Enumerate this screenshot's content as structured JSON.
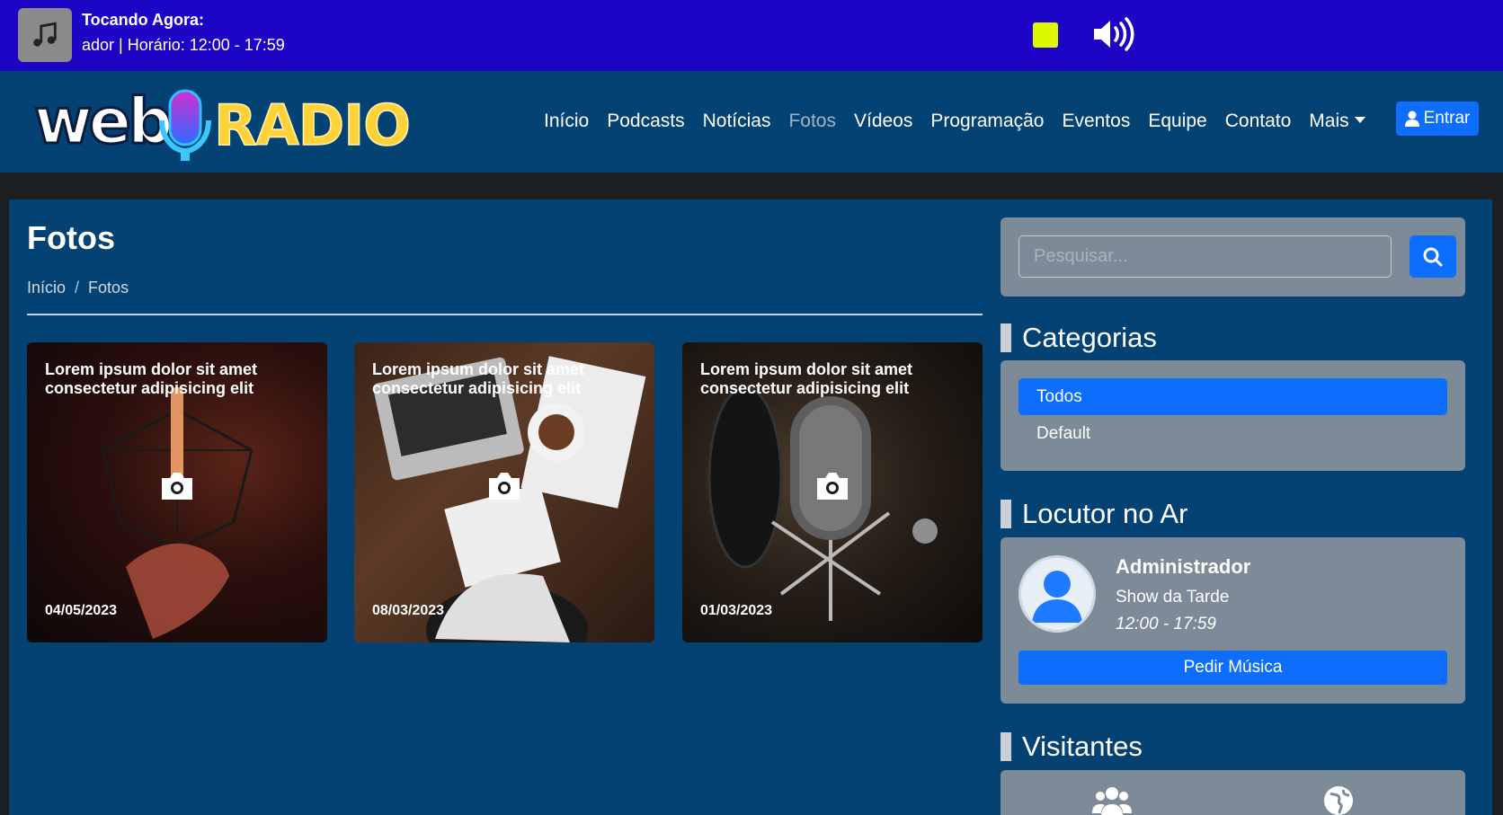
{
  "player": {
    "now_playing_label": "Tocando Agora:",
    "now_playing_text": "ador | Horário: 12:00 - 17:59"
  },
  "nav": {
    "items": [
      {
        "label": "Início"
      },
      {
        "label": "Podcasts"
      },
      {
        "label": "Notícias"
      },
      {
        "label": "Fotos",
        "active": true
      },
      {
        "label": "Vídeos"
      },
      {
        "label": "Programação"
      },
      {
        "label": "Eventos"
      },
      {
        "label": "Equipe"
      },
      {
        "label": "Contato"
      },
      {
        "label": "Mais"
      }
    ],
    "login_label": "Entrar"
  },
  "logo": {
    "text_web": "web",
    "text_radio": "RADIO"
  },
  "page": {
    "title": "Fotos",
    "breadcrumb": [
      "Início",
      "Fotos"
    ]
  },
  "photos": [
    {
      "caption": "Lorem ipsum dolor sit amet consectetur adipisicing elit",
      "date": "04/05/2023"
    },
    {
      "caption": "Lorem ipsum dolor sit amet consectetur adipisicing elit",
      "date": "08/03/2023"
    },
    {
      "caption": "Lorem ipsum dolor sit amet consectetur adipisicing elit",
      "date": "01/03/2023"
    }
  ],
  "sidebar": {
    "search_placeholder": "Pesquisar...",
    "categories_title": "Categorias",
    "categories": [
      {
        "label": "Todos",
        "active": true
      },
      {
        "label": "Default"
      }
    ],
    "locutor_title": "Locutor no Ar",
    "locutor": {
      "name": "Administrador",
      "show": "Show da Tarde",
      "time": "12:00 - 17:59",
      "request_label": "Pedir Música"
    },
    "visitors_title": "Visitantes"
  },
  "colors": {
    "player_bg": "#1d05c5",
    "nav_bg": "#034272",
    "accent": "#0d6efd",
    "stop_button": "#ddf900"
  }
}
